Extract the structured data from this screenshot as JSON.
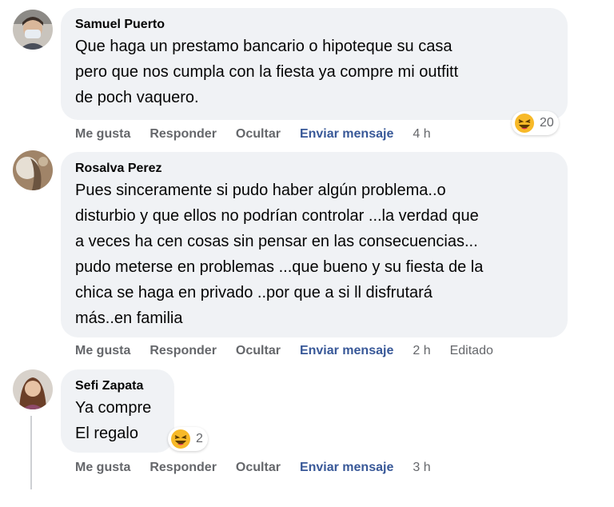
{
  "comments": [
    {
      "author": "Samuel Puerto",
      "text": "Que haga un prestamo bancario o hipoteque su casa\npero que nos cumpla con la fiesta ya compre mi outfitt\nde poch vaquero.",
      "actions": {
        "like": "Me gusta",
        "reply": "Responder",
        "hide": "Ocultar",
        "message": "Enviar mensaje",
        "time": "4 h",
        "edited": ""
      },
      "reaction": {
        "icon": "laughing-emoji-icon",
        "count": "20"
      }
    },
    {
      "author": "Rosalva Perez",
      "text": "Pues sinceramente si pudo haber algún problema..o\ndisturbio y que ellos no podrían controlar ...la verdad que\na veces ha cen cosas sin pensar en las consecuencias...\npudo meterse en problemas ...que bueno y su fiesta de la\nchica se haga en privado ..por que a si ll disfrutará\nmás..en familia",
      "actions": {
        "like": "Me gusta",
        "reply": "Responder",
        "hide": "Ocultar",
        "message": "Enviar mensaje",
        "time": "2 h",
        "edited": "Editado"
      },
      "reaction": null
    },
    {
      "author": "Sefi Zapata",
      "text": "Ya compre\nEl regalo",
      "actions": {
        "like": "Me gusta",
        "reply": "Responder",
        "hide": "Ocultar",
        "message": "Enviar mensaje",
        "time": "3 h",
        "edited": ""
      },
      "reaction": {
        "icon": "laughing-emoji-icon",
        "count": "2"
      }
    }
  ],
  "colors": {
    "bubble": "#f0f2f5",
    "link": "#385898",
    "meta": "#65676b",
    "text": "#050505"
  }
}
